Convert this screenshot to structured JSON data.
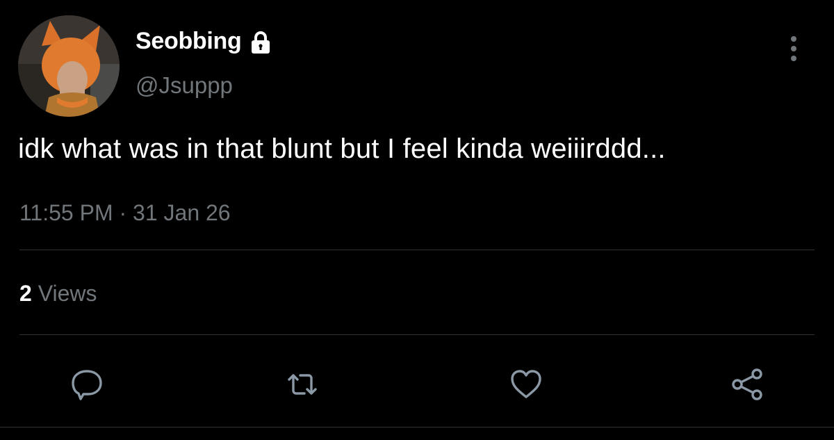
{
  "author": {
    "display_name": "Seobbing",
    "handle": "@Jsuppp",
    "avatar_icon": "profile-photo",
    "protected_icon": "lock-icon"
  },
  "tweet": {
    "text": "idk what was in that blunt but I feel kinda weiiirddd...",
    "time": "11:55 PM",
    "separator": "·",
    "date": "31 Jan 26"
  },
  "stats": {
    "views_count": "2",
    "views_label": "Views"
  },
  "actions": [
    {
      "name": "reply",
      "icon": "speech-bubble-icon"
    },
    {
      "name": "retweet",
      "icon": "retweet-arrows-icon"
    },
    {
      "name": "like",
      "icon": "heart-icon"
    },
    {
      "name": "share",
      "icon": "share-nodes-icon"
    }
  ],
  "colors": {
    "background": "#000000",
    "primary_text": "#ffffff",
    "secondary_text": "#71767b",
    "divider": "#2f3336",
    "icon": "#8b98a5"
  }
}
